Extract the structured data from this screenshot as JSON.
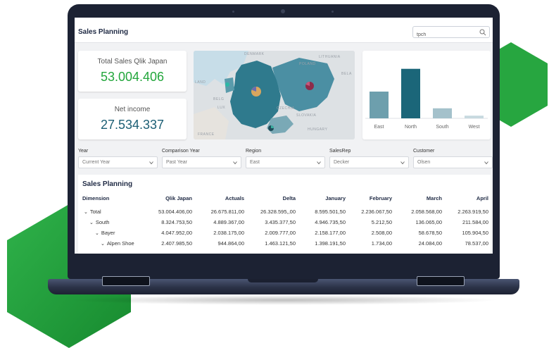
{
  "app": {
    "title": "Sales Planning",
    "search": {
      "value": "tpch"
    }
  },
  "kpis": [
    {
      "label": "Total Sales Qlik Japan",
      "value": "53.004.406",
      "color": "#22a63b"
    },
    {
      "label": "Net income",
      "value": "27.534.337",
      "color": "#1b5e74"
    }
  ],
  "map": {
    "country_labels": [
      "DENMARK",
      "LITHUANIA",
      "BELA",
      "POLAND",
      "CZECHIA",
      "SLOVAKIA",
      "HUNGARY",
      "FRANCE",
      "BELG",
      "LUX",
      "LAND"
    ]
  },
  "chart_data": {
    "type": "bar",
    "categories": [
      "East",
      "North",
      "South",
      "West"
    ],
    "values": [
      40,
      74,
      15,
      4
    ],
    "colors": [
      "#6d9fad",
      "#1b6679",
      "#a4c1cb",
      "#c7d9df"
    ],
    "ylim": [
      0,
      80
    ],
    "title": "",
    "xlabel": "",
    "ylabel": ""
  },
  "filters": [
    {
      "label": "Year",
      "value": "Current Year"
    },
    {
      "label": "Comparison Year",
      "value": "Past Year"
    },
    {
      "label": "Region",
      "value": "East"
    },
    {
      "label": "SalesRep",
      "value": "Decker"
    },
    {
      "label": "Customer",
      "value": "Olsen"
    }
  ],
  "table": {
    "title": "Sales Planning",
    "columns": [
      "Dimension",
      "Qlik Japan",
      "Actuals",
      "Delta",
      "January",
      "February",
      "March",
      "April"
    ],
    "rows": [
      {
        "level": 0,
        "dimension": "Total",
        "cells": [
          "53.004.406,00",
          "26.675.811,00",
          "26.328.595,,00",
          "8.595.501,50",
          "2.236.067,50",
          "2.058.568,00",
          "2.263.919,50"
        ]
      },
      {
        "level": 1,
        "dimension": "South",
        "cells": [
          "8.324.753,50",
          "4.889.367,00",
          "3.435.377,50",
          "4.946.735,50",
          "5.212,50",
          "136.065,00",
          "211.584,00"
        ]
      },
      {
        "level": 2,
        "dimension": "Bayer",
        "cells": [
          "4.047.952,00",
          "2.038.175,00",
          "2.009.777,00",
          "2.158.177,00",
          "2.508,00",
          "58.678,50",
          "105.904,50"
        ]
      },
      {
        "level": 3,
        "dimension": "Alpen Shoe",
        "cells": [
          "2.407.985,50",
          "944.864,00",
          "1.463.121,50",
          "1.398.191,50",
          "1.734,00",
          "24.084,00",
          "78.537,00"
        ]
      }
    ]
  },
  "colors": {
    "brand_green": "#22a63b",
    "teal": "#1b6679",
    "laptop": "#1c2233"
  }
}
